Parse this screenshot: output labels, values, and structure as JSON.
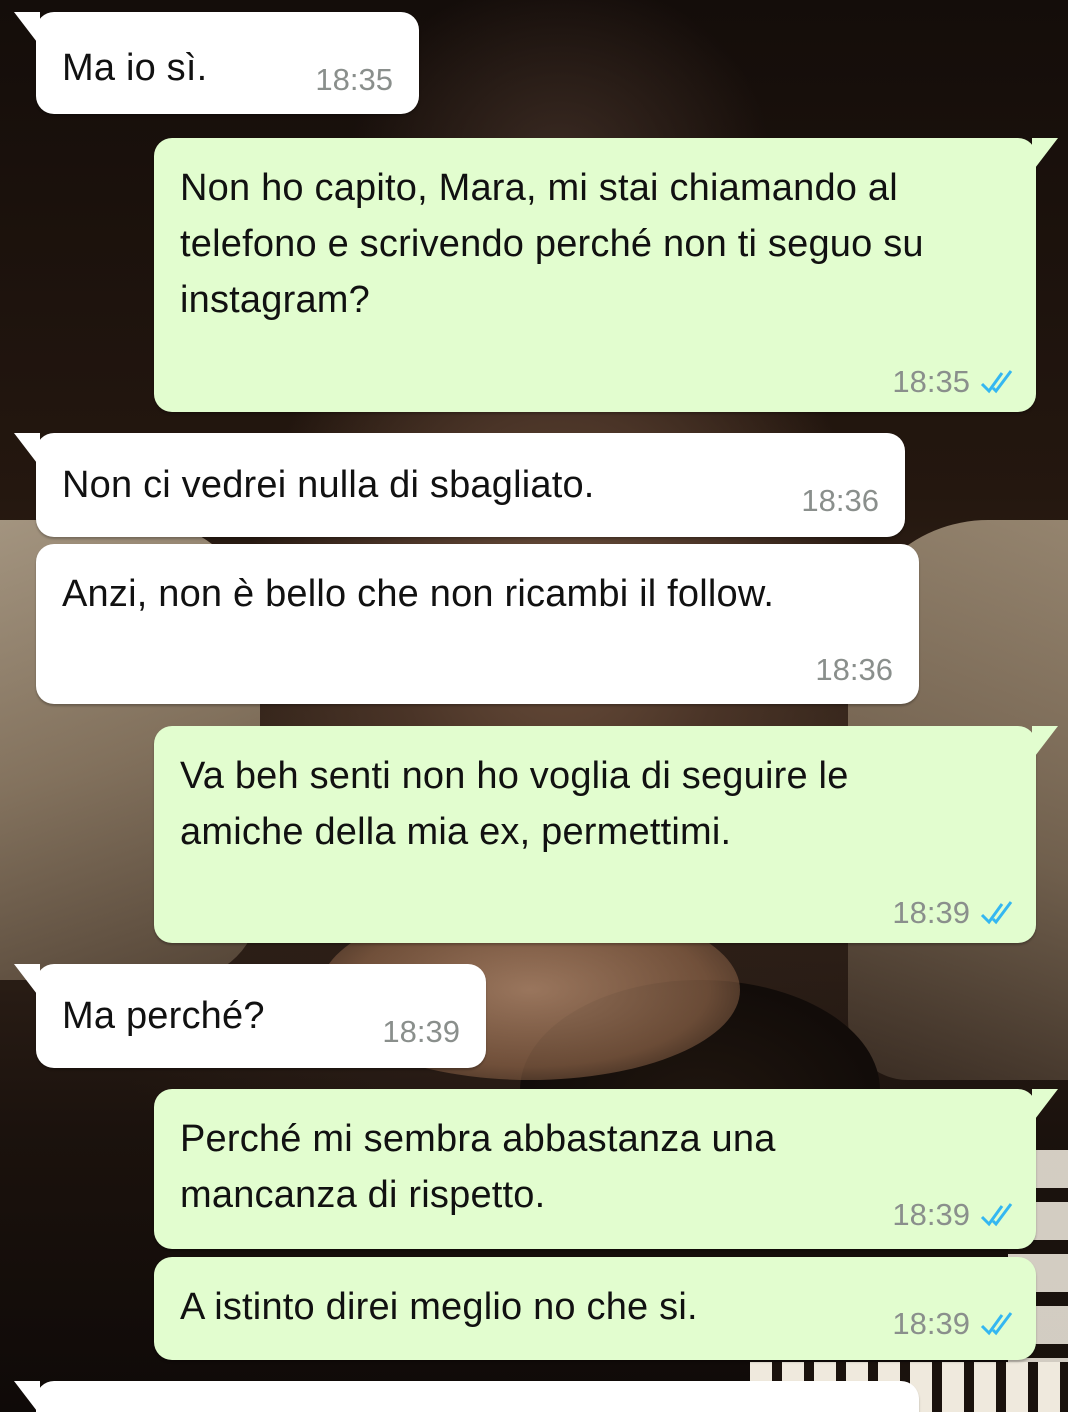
{
  "theme": {
    "incoming_bg": "#ffffff",
    "outgoing_bg": "#e2fdcf",
    "time_color": "#8a8f8c",
    "read_check_color": "#34b7f1"
  },
  "messages": [
    {
      "direction": "in",
      "text": "Ma io sì.",
      "time": "18:35"
    },
    {
      "direction": "out",
      "text": "Non ho capito, Mara, mi stai chiamando al telefono e scrivendo perché non ti seguo su instagram?",
      "time": "18:35",
      "status_icon": "double-check-read-icon"
    },
    {
      "direction": "in",
      "text": "Non ci vedrei nulla di sbagliato.",
      "time": "18:36"
    },
    {
      "direction": "in",
      "text": "Anzi, non è bello che non ricambi il follow.",
      "time": "18:36"
    },
    {
      "direction": "out",
      "text": "Va beh senti non ho voglia di seguire le amiche della mia ex, permettimi.",
      "time": "18:39",
      "status_icon": "double-check-read-icon"
    },
    {
      "direction": "in",
      "text": "Ma perché?",
      "time": "18:39"
    },
    {
      "direction": "out",
      "text": "Perché mi sembra abbastanza una mancanza di rispetto.",
      "time": "18:39",
      "status_icon": "double-check-read-icon"
    },
    {
      "direction": "out",
      "text": "A istinto direi meglio no che si.",
      "time": "18:39",
      "status_icon": "double-check-read-icon"
    }
  ]
}
